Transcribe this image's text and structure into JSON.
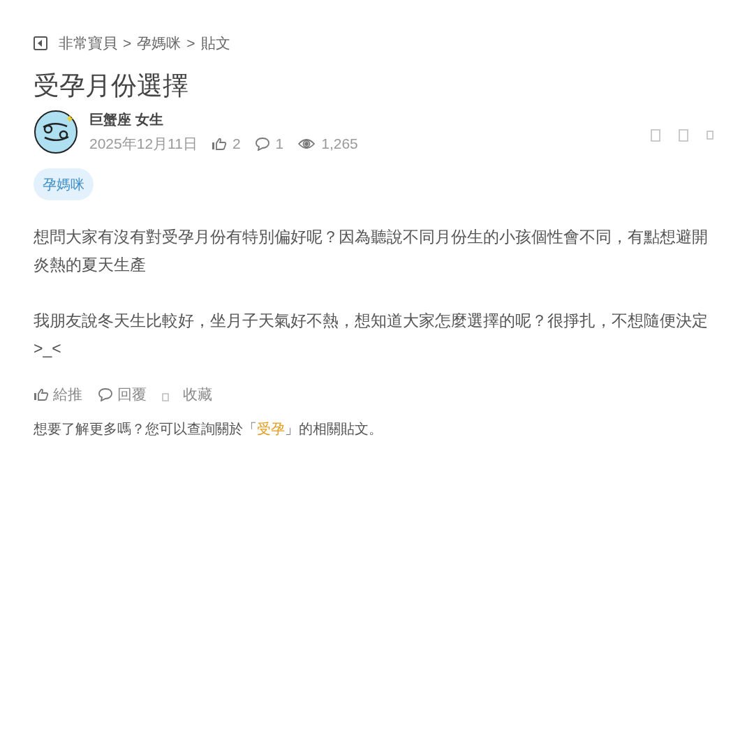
{
  "breadcrumb": [
    "非常寶貝",
    "孕媽咪",
    "貼文"
  ],
  "breadcrumb_separator": ">",
  "title": "受孕月份選擇",
  "author": {
    "name": "巨蟹座 女生",
    "date": "2025年12月11日",
    "likes": "2",
    "comments": "1",
    "views": "1,265"
  },
  "tag": "孕媽咪",
  "paragraphs": [
    "想問大家有沒有對受孕月份有特別偏好呢？因為聽說不同月份生的小孩個性會不同，有點想避開炎熱的夏天生產",
    "我朋友說冬天生比較好，坐月子天氣好不熱，想知道大家怎麼選擇的呢？很掙扎，不想隨便決定 >_<"
  ],
  "actions": [
    {
      "kind": "like",
      "label": "給推"
    },
    {
      "kind": "reply",
      "label": "回覆"
    },
    {
      "kind": "save",
      "label": "收藏"
    }
  ],
  "related": {
    "before": "想要了解更多嗎？您可以查詢關於「",
    "keyword": "受孕",
    "after": "」的相關貼文。"
  }
}
